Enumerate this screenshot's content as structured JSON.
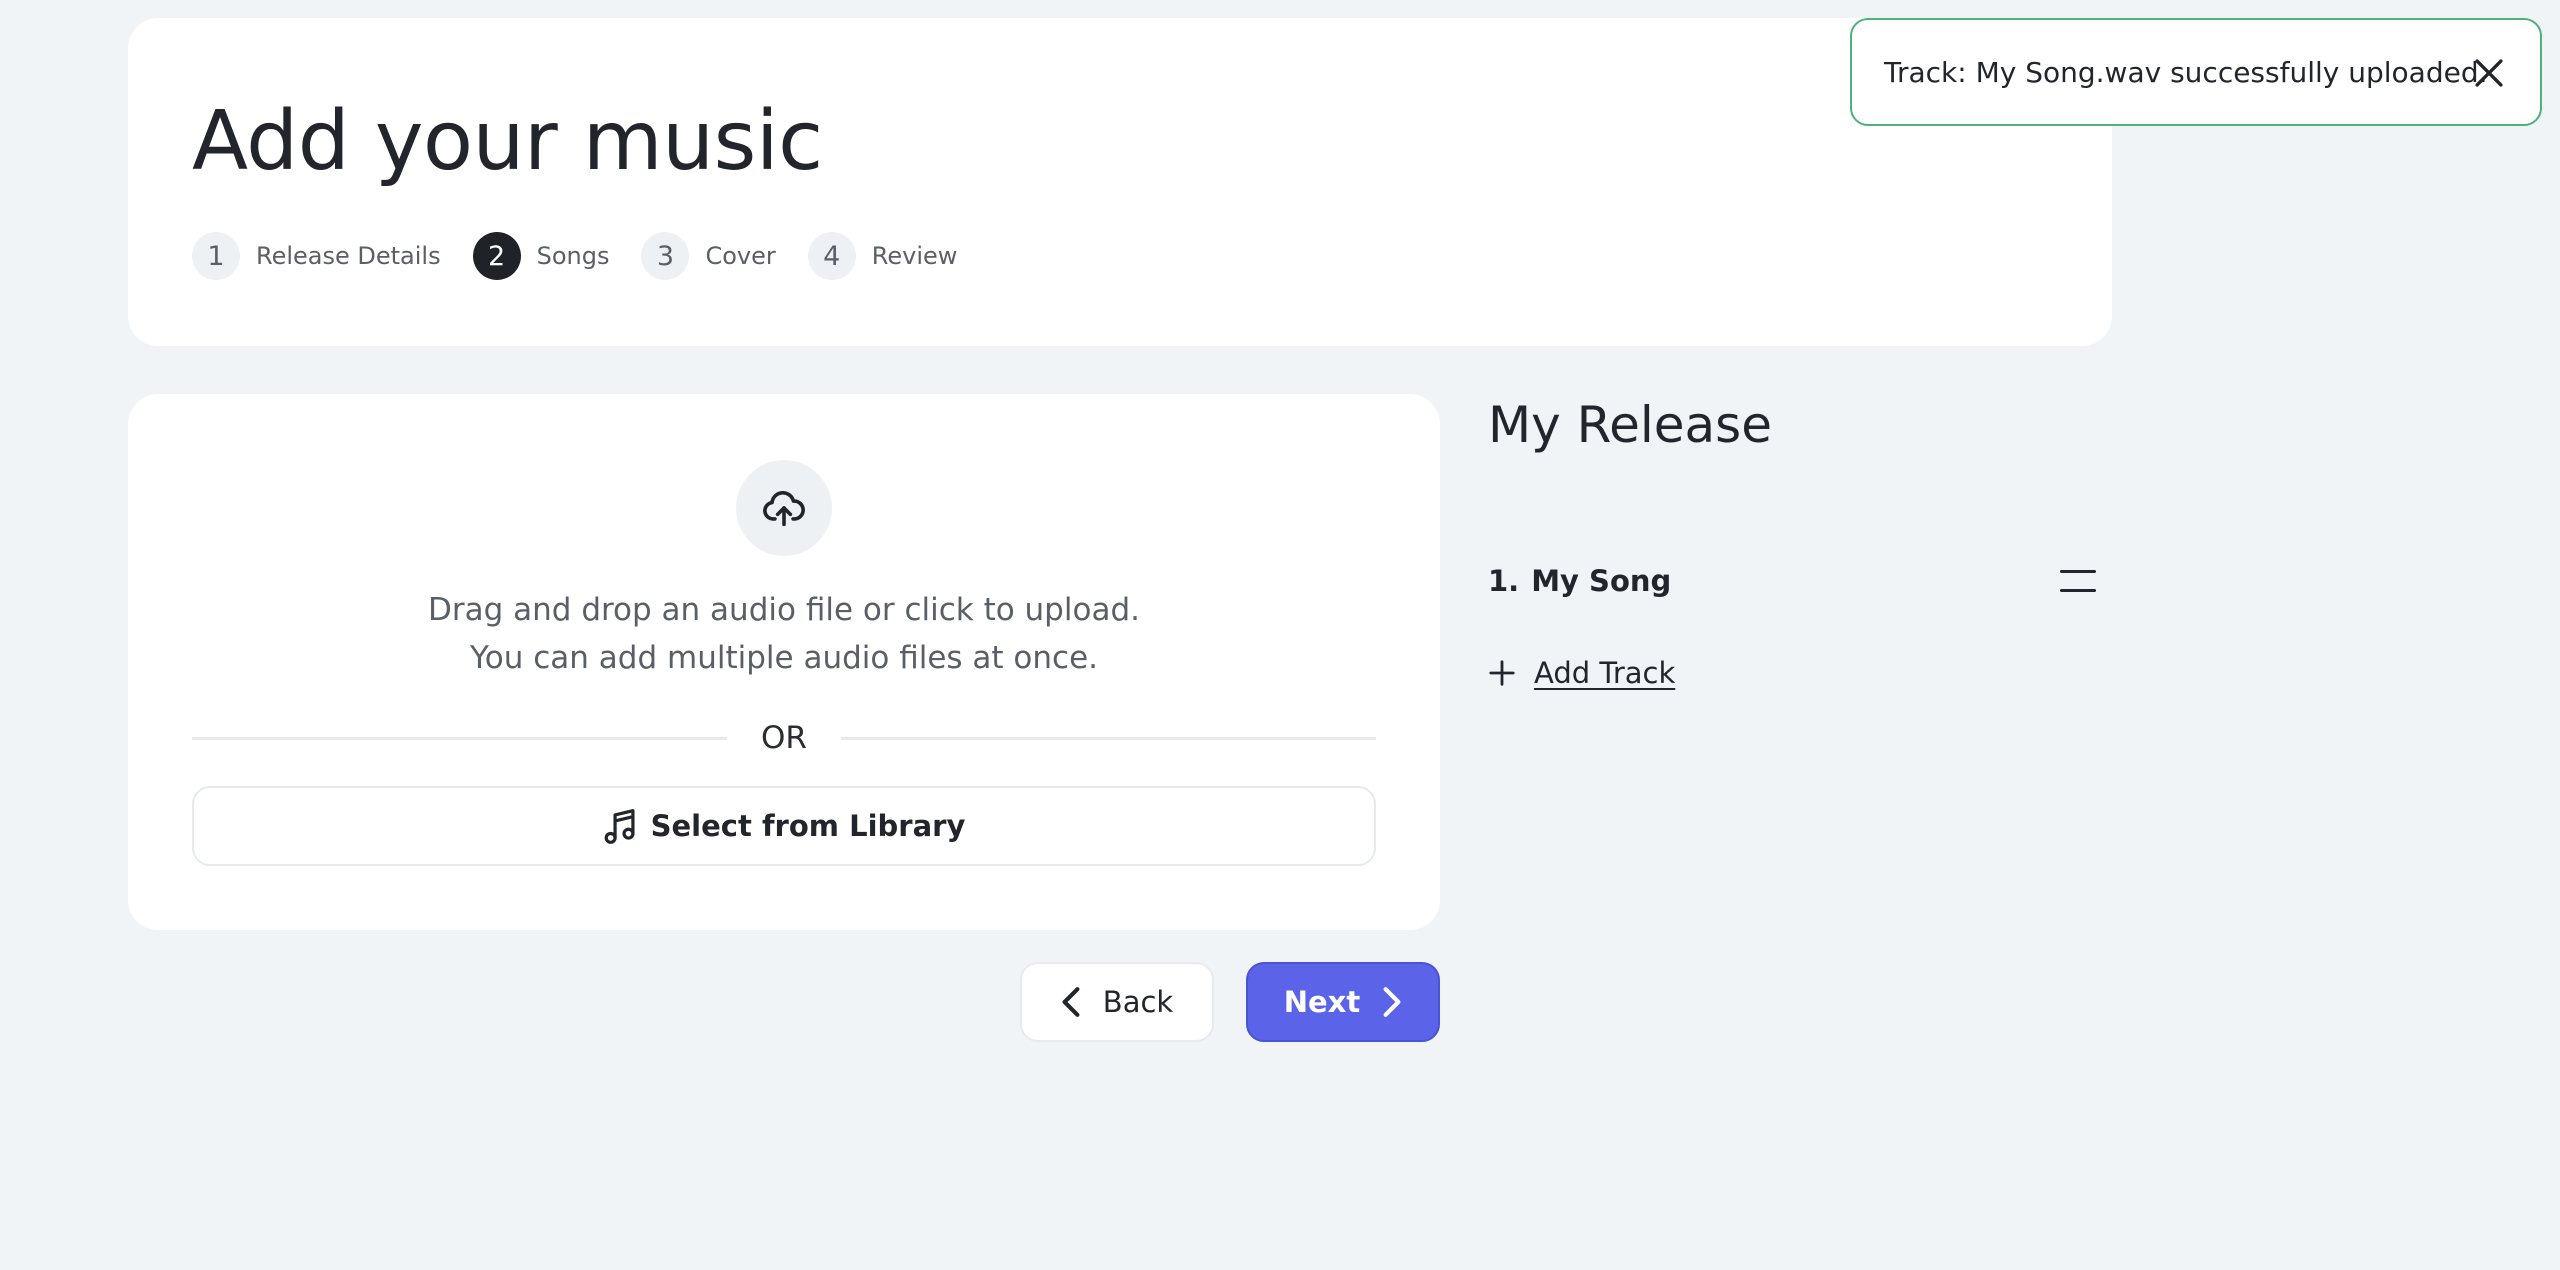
{
  "header": {
    "title": "Add your music",
    "steps": [
      {
        "number": "1",
        "label": "Release Details",
        "active": false
      },
      {
        "number": "2",
        "label": "Songs",
        "active": true
      },
      {
        "number": "3",
        "label": "Cover",
        "active": false
      },
      {
        "number": "4",
        "label": "Review",
        "active": false
      }
    ]
  },
  "upload": {
    "icon": "cloud-upload-icon",
    "line1": "Drag and drop an audio file or click to upload.",
    "line2": "You can add multiple audio files at once.",
    "divider_text": "OR",
    "library_button": "Select from Library",
    "library_icon": "music-note-icon"
  },
  "navigation": {
    "back_label": "Back",
    "next_label": "Next"
  },
  "release": {
    "title": "My Release",
    "tracks": [
      {
        "number": "1.",
        "name": "My Song"
      }
    ],
    "add_track_label": "Add Track"
  },
  "toast": {
    "message": "Track: My Song.wav successfully uploaded."
  },
  "colors": {
    "background": "#f1f4f7",
    "primary": "#5b63e8",
    "success_border": "#4cb37a",
    "active_step": "#1f2226"
  }
}
